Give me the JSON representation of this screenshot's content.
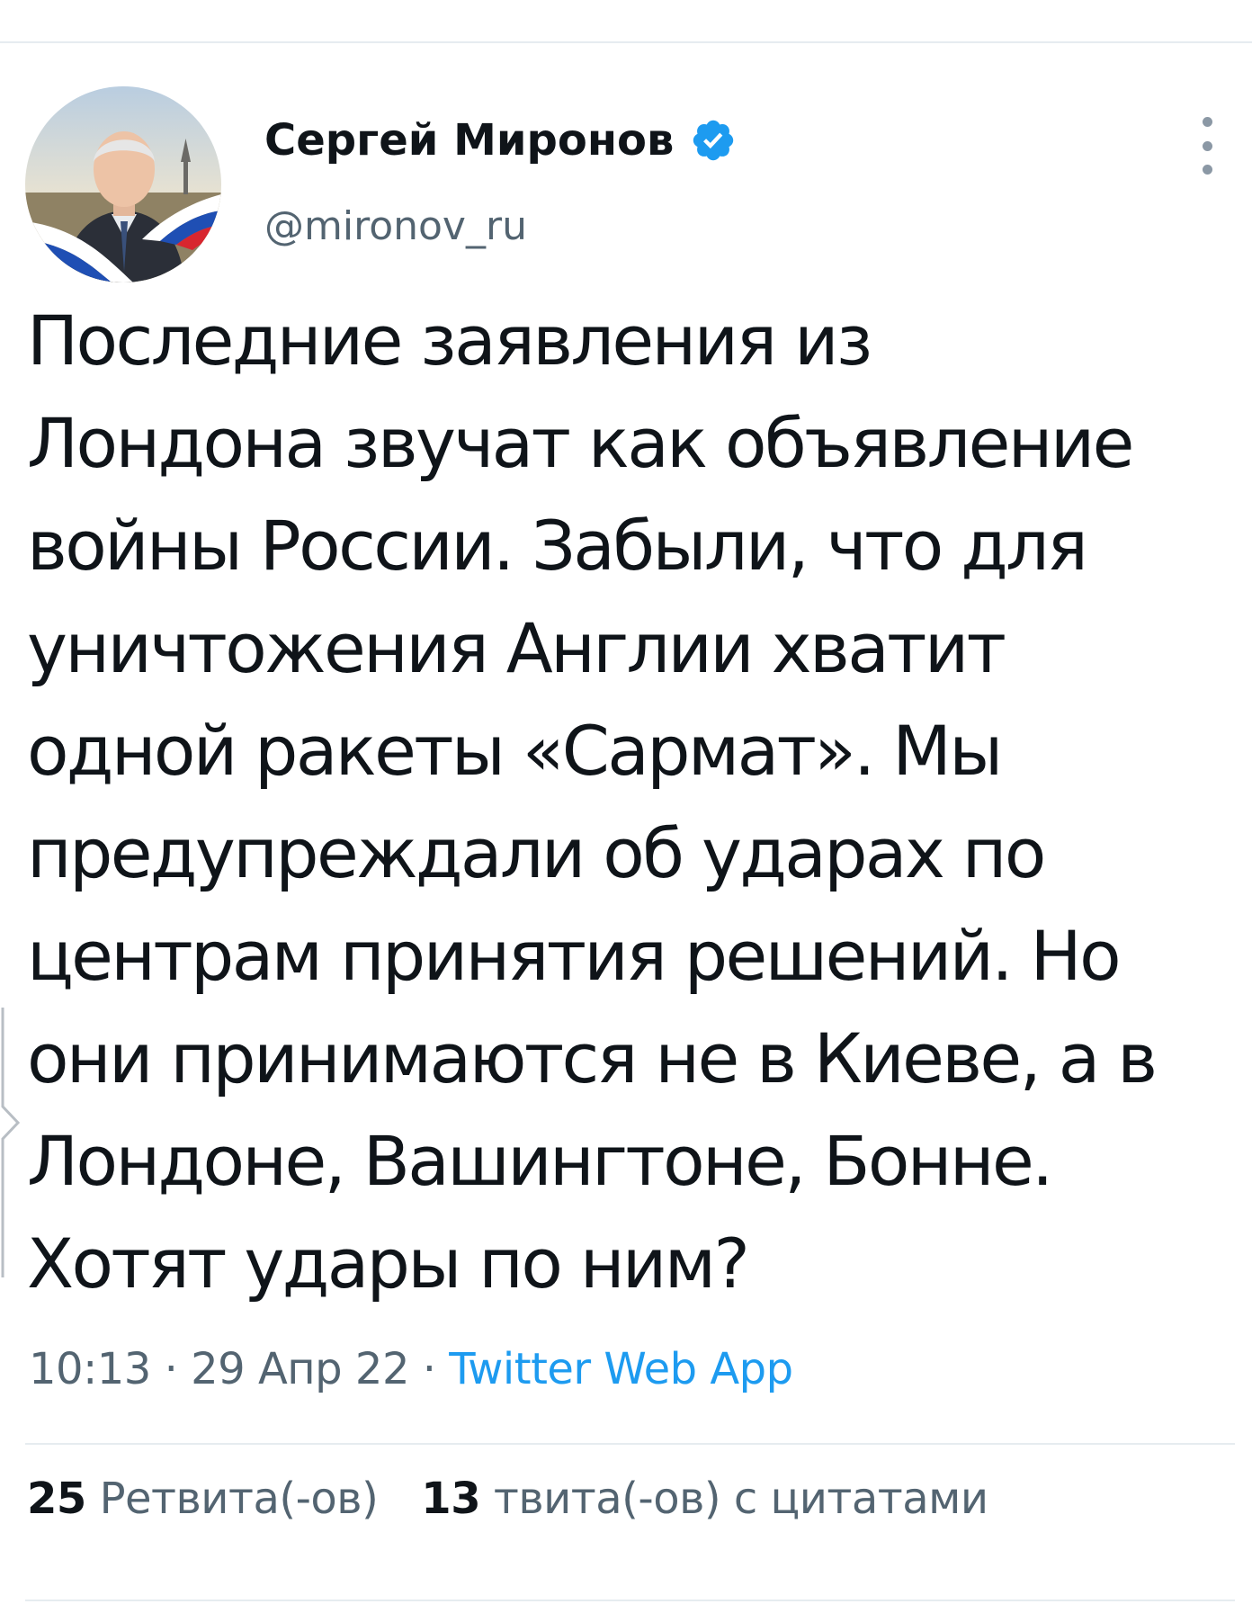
{
  "tweet": {
    "author": {
      "display_name": "Сергей Миронов",
      "handle": "@mironov_ru",
      "verified": true
    },
    "text": "Последние заявления из\nЛондона звучат как объявление\nвойны России. Забыли, что для\nуничтожения Англии хватит\nодной ракеты «Сармат». Мы\nпредупреждали об ударах по\nцентрам принятия решений. Но\nони принимаются не в Киеве, а в\nЛондоне, Вашингтоне, Бонне.\nХотят удары по ним?",
    "time": "10:13",
    "date": "29 Апр 22",
    "separator": "·",
    "source": "Twitter Web App",
    "stats": {
      "retweets_count": "25",
      "retweets_label": "Ретвита(-ов)",
      "quotes_count": "13",
      "quotes_label": "твита(-ов) с цитатами"
    }
  },
  "colors": {
    "accent": "#1d9bf0",
    "text_primary": "#0f1419",
    "text_secondary": "#536471",
    "divider": "#e6ecf0",
    "verified_badge": "#1d9bf0"
  },
  "icons": {
    "verified": "verified-badge-icon",
    "more": "more-vertical-icon"
  }
}
